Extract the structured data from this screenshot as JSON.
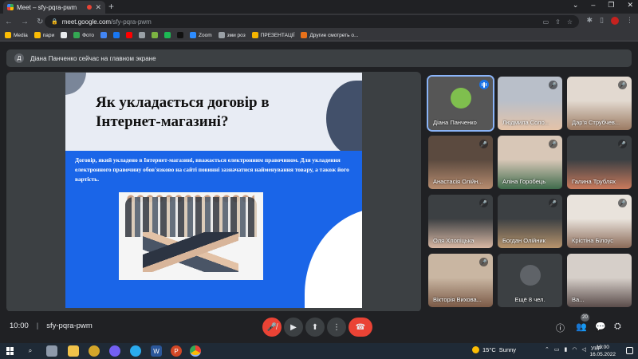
{
  "browser": {
    "tab_title": "Meet – sfy-pqra-pwm",
    "new_tab": "+",
    "url_host": "meet.google.com",
    "url_path": "/sfy-pqra-pwm",
    "bookmarks": [
      {
        "label": "Media",
        "icon": "folder-icon"
      },
      {
        "label": "пари",
        "icon": "folder-icon"
      },
      {
        "label": "",
        "icon": "github-icon"
      },
      {
        "label": "Фото",
        "icon": "google-photos-icon"
      },
      {
        "label": "",
        "icon": "chrome-icon"
      },
      {
        "label": "",
        "icon": "facebook-icon"
      },
      {
        "label": "",
        "icon": "youtube-icon"
      },
      {
        "label": "",
        "icon": "bookmark-icon"
      },
      {
        "label": "",
        "icon": "torrent-icon"
      },
      {
        "label": "",
        "icon": "spotify-icon"
      },
      {
        "label": "",
        "icon": "app-icon"
      },
      {
        "label": "Zoom",
        "icon": "zoom-icon"
      },
      {
        "label": "зми роз",
        "icon": "bookmark-icon"
      },
      {
        "label": "ПРЕЗЕНТАЦІЇ",
        "icon": "slides-icon"
      },
      {
        "label": "Другие смотреть о...",
        "icon": "site-icon"
      }
    ]
  },
  "presenting": {
    "avatar_letter": "Д",
    "text": "Діана Панченко сейчас на главном экране"
  },
  "slide": {
    "title_line1": "Як укладається договір в",
    "title_line2": "Інтернет-магазині?",
    "body": "Договір, який укладено в Інтернет-магазині, вважається електронним правочином. Для укладення електронного правочину обов'язково на сайті повинні зазначатися найменування товару, а також його вартість."
  },
  "participants": [
    {
      "name": "Діана Панченко",
      "state": "speaking",
      "colors": [
        "#565656",
        "#7fbf4e"
      ]
    },
    {
      "name": "Людмила Соло...",
      "state": "muted",
      "colors": [
        "#b9bfc9",
        "#e4c3a8"
      ]
    },
    {
      "name": "Дар'я Струбчев...",
      "state": "muted",
      "colors": [
        "#e2d9d0",
        "#9b7a62"
      ]
    },
    {
      "name": "Анастасія Олійн...",
      "state": "muted",
      "colors": [
        "#5b4a3f",
        "#b78c6f"
      ]
    },
    {
      "name": "Аліна Горобець",
      "state": "muted",
      "colors": [
        "#d8c7b7",
        "#3f6b4c"
      ]
    },
    {
      "name": "Галина Трублях",
      "state": "muted",
      "colors": [
        "#3c4043",
        "#c97a5c"
      ]
    },
    {
      "name": "Оля Хлопіцька",
      "state": "muted",
      "colors": [
        "#3c4043",
        "#d9b8a4"
      ]
    },
    {
      "name": "Богдан Олійник",
      "state": "muted",
      "colors": [
        "#3c4043",
        "#b8956d"
      ]
    },
    {
      "name": "Крістіна Білоус",
      "state": "muted",
      "colors": [
        "#e9e3dc",
        "#8a6a58"
      ]
    },
    {
      "name": "Вікторія Вихова...",
      "state": "muted",
      "colors": [
        "#c9b6a2",
        "#7b5a47"
      ]
    },
    {
      "name": "Ещё 8 чел.",
      "state": "more",
      "colors": [
        "#3c4043",
        "#5f6368"
      ]
    },
    {
      "name": "Ва...",
      "state": "none",
      "colors": [
        "#d6cfc9",
        "#5a4c4a"
      ]
    }
  ],
  "meeting": {
    "time": "10:00",
    "separator": "|",
    "code": "sfy-pqra-pwm",
    "participant_count": "20"
  },
  "taskbar": {
    "temperature": "15°C",
    "weather": "Sunny",
    "language": "УКР",
    "time": "10:00",
    "date": "16.05.2022"
  },
  "colors": {
    "meet_bg": "#202124",
    "tile_bg": "#3c4043",
    "accent_blue": "#1a73e8",
    "hangup_red": "#ea4335",
    "slide_blue": "#1a65e8"
  }
}
